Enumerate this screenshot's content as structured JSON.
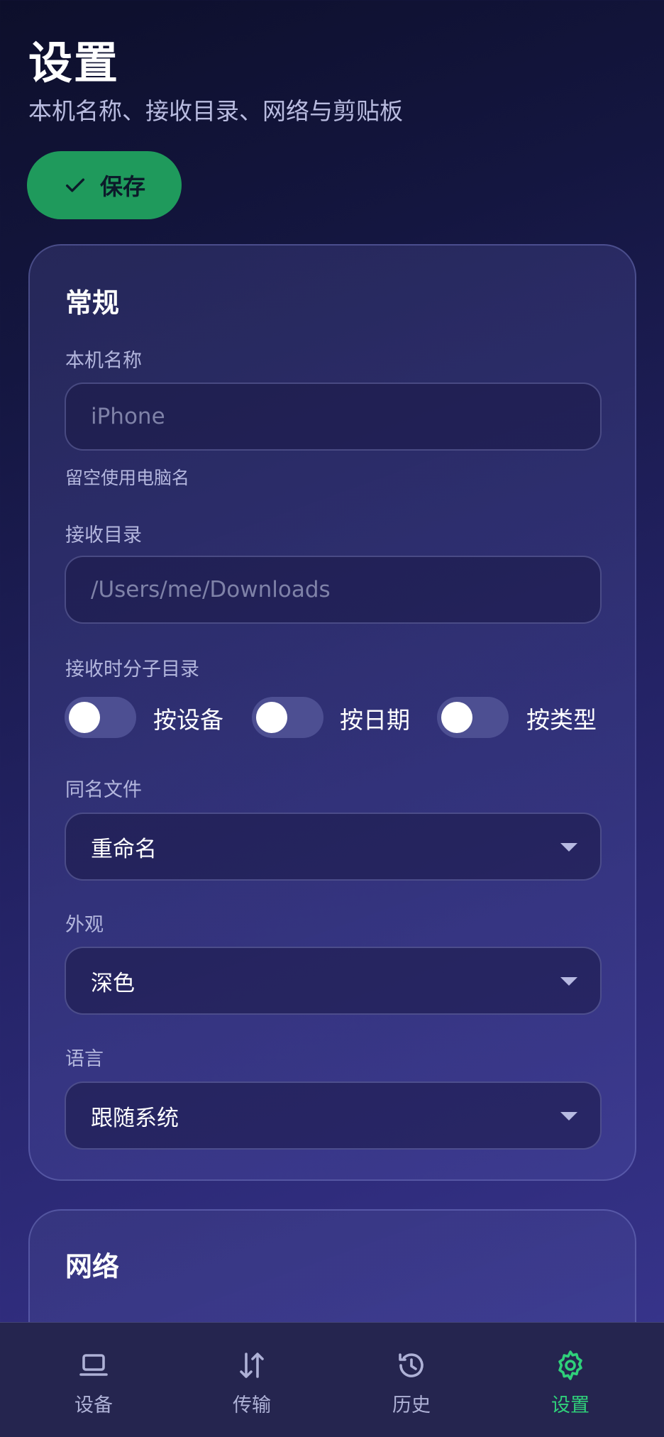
{
  "header": {
    "title": "设置",
    "subtitle": "本机名称、接收目录、网络与剪贴板"
  },
  "actions": {
    "save_label": "保存",
    "save_icon": "check-icon",
    "save_color": "#1f9a5c"
  },
  "general": {
    "title": "常规",
    "device_name": {
      "label": "本机名称",
      "value": "",
      "placeholder": "iPhone",
      "hint": "留空使用电脑名"
    },
    "receive_dir": {
      "label": "接收目录",
      "value": "",
      "placeholder": "/Users/me/Downloads"
    },
    "subfolders": {
      "label": "接收时分子目录",
      "options": [
        {
          "label": "按设备",
          "on": false
        },
        {
          "label": "按日期",
          "on": false
        },
        {
          "label": "按类型",
          "on": false
        }
      ]
    },
    "same_name": {
      "label": "同名文件",
      "selected": "重命名"
    },
    "appearance": {
      "label": "外观",
      "selected": "深色"
    },
    "language": {
      "label": "语言",
      "selected": "跟随系统"
    }
  },
  "network": {
    "title": "网络"
  },
  "tabs": [
    {
      "label": "设备",
      "icon": "laptop-icon",
      "active": false
    },
    {
      "label": "传输",
      "icon": "transfer-arrows-icon",
      "active": false
    },
    {
      "label": "历史",
      "icon": "history-icon",
      "active": false
    },
    {
      "label": "设置",
      "icon": "gear-icon",
      "active": true
    }
  ],
  "colors": {
    "accent": "#2fd07a",
    "background": "#1b1c52"
  }
}
